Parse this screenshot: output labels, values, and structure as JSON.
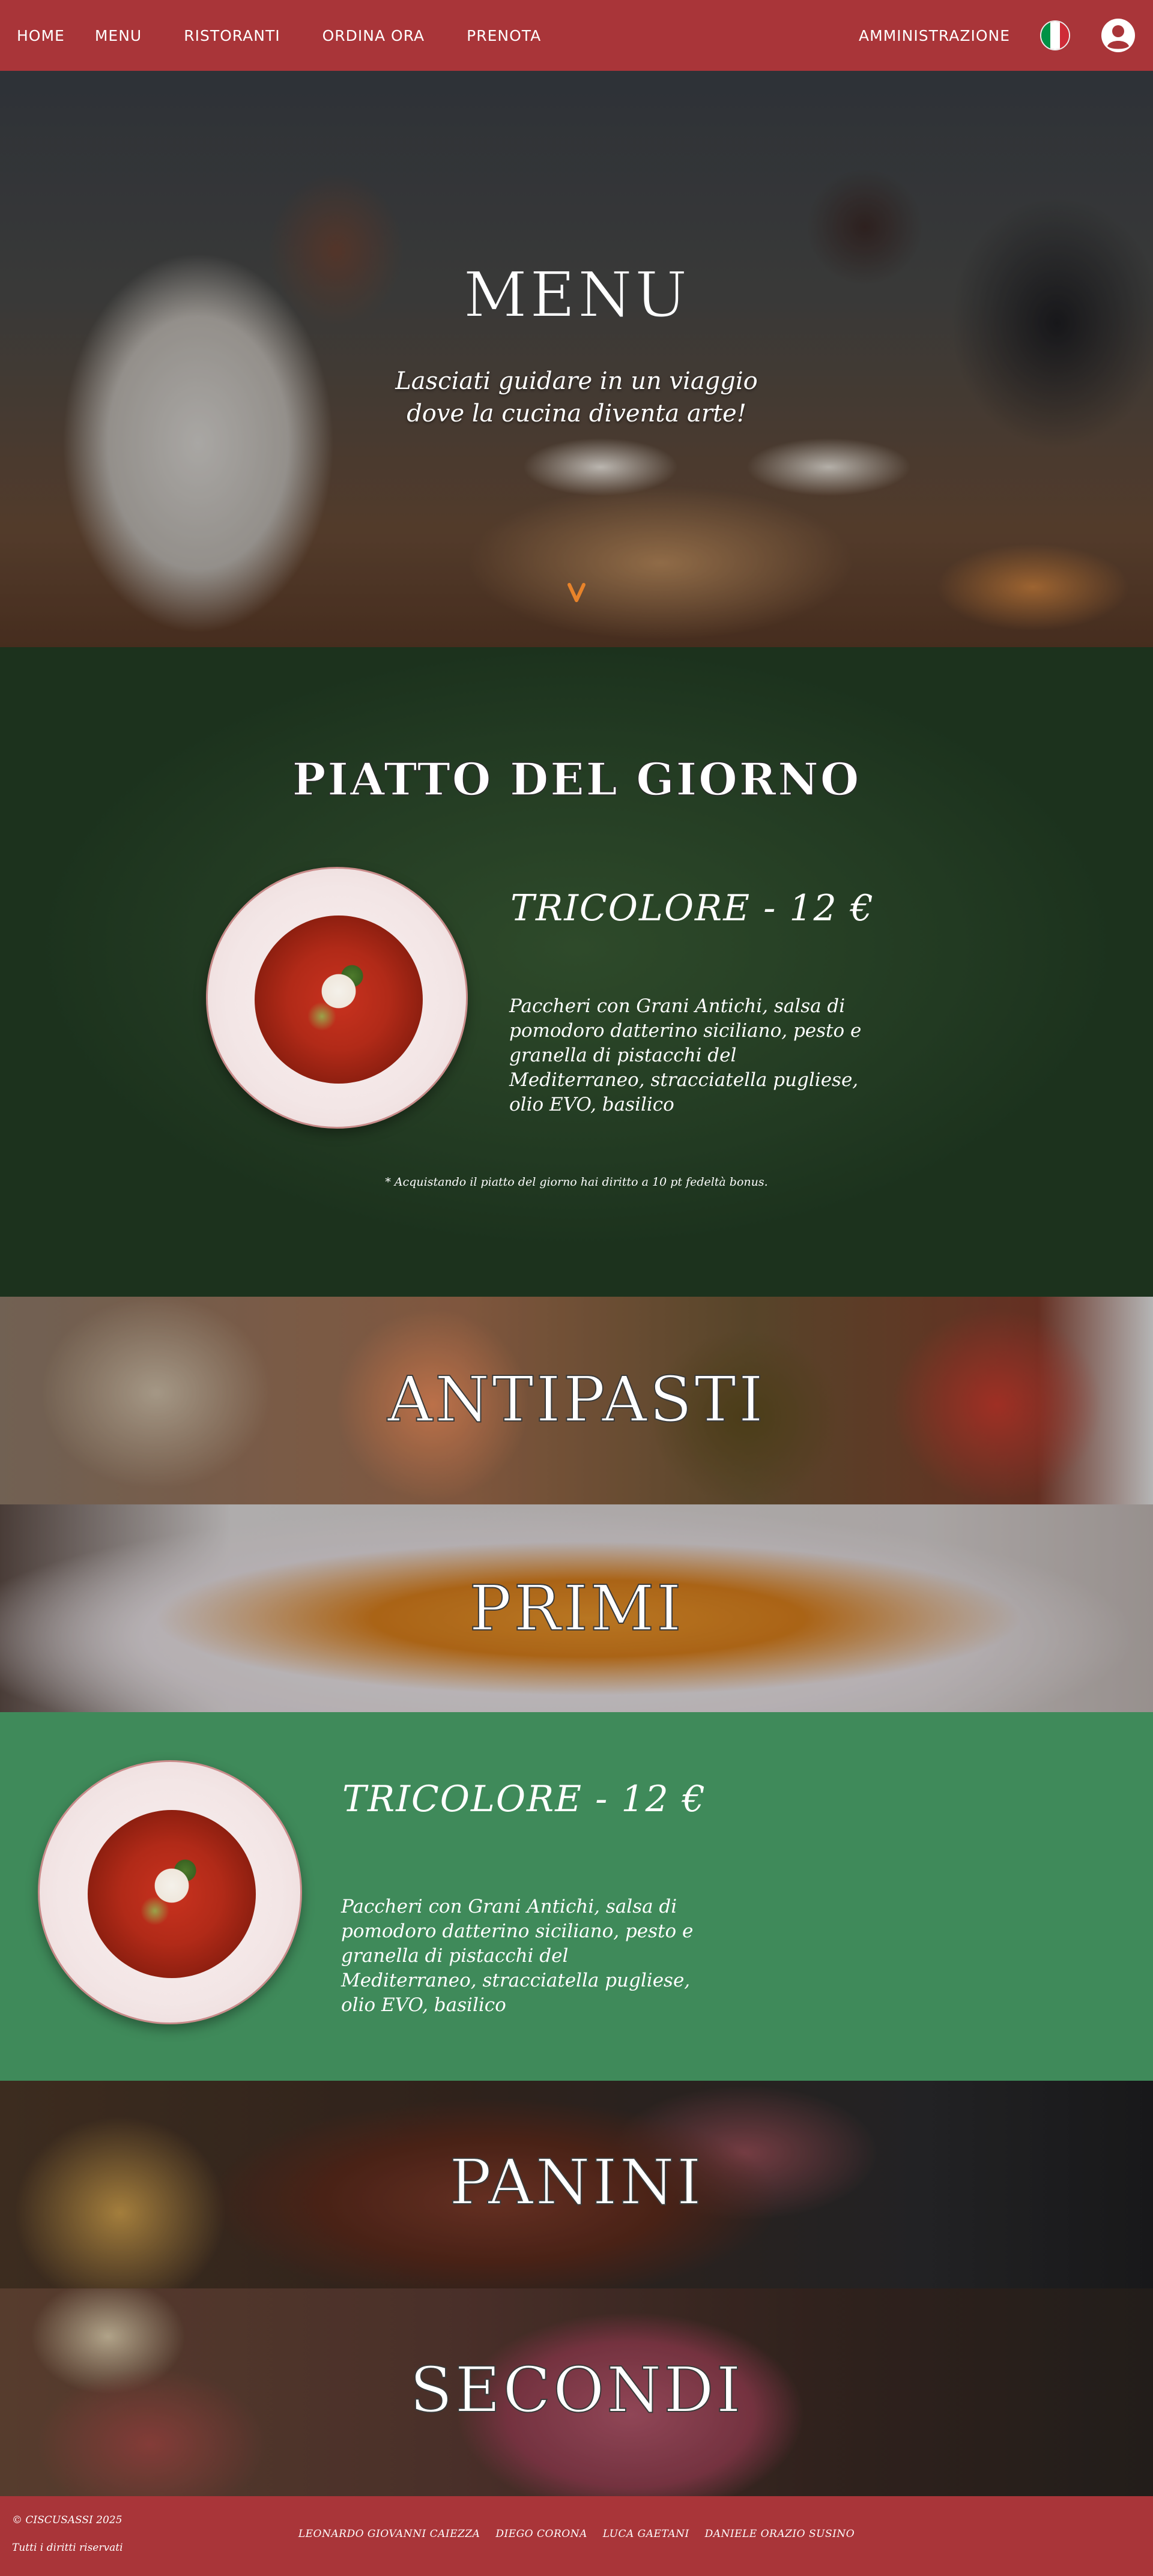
{
  "nav": {
    "links": [
      "HOME",
      "MENU",
      "RISTORANTI",
      "ORDINA ORA",
      "PRENOTA"
    ],
    "admin_label": "AMMINISTRAZIONE",
    "flag_colors": [
      "#009246",
      "#ffffff",
      "#ce2b37"
    ],
    "user_icon": "user-circle-icon"
  },
  "hero": {
    "title": "MENU",
    "subtitle_line1": "Lasciati guidare in un viaggio",
    "subtitle_line2": "dove la cucina diventa arte!",
    "scroll_icon": "chevron-down-icon"
  },
  "piatto_del_giorno": {
    "title": "PIATTO DEL GIORNO",
    "dish_name": "TRICOLORE - 12 €",
    "description": [
      "Paccheri con Grani Antichi, salsa di",
      "pomodoro datterino siciliano, pesto e",
      "granella di pistacchi del",
      "Mediterraneo, stracciatella pugliese,",
      "olio  EVO, basilico"
    ],
    "note": "* Acquistando il piatto del giorno hai diritto a 10 pt fedeltà bonus."
  },
  "categories": {
    "antipasti": "ANTIPASTI",
    "primi": "PRIMI",
    "panini": "PANINI",
    "secondi": "SECONDI"
  },
  "primi_item": {
    "dish_name": "TRICOLORE - 12 €",
    "description": [
      "Paccheri con Grani Antichi, salsa di",
      "pomodoro datterino siciliano, pesto e",
      "granella di pistacchi del",
      "Mediterraneo, stracciatella pugliese,",
      "olio  EVO, basilico"
    ]
  },
  "footer": {
    "copyright": "© CISCUSASSI 2025",
    "rights": "Tutti i diritti riservati",
    "authors": [
      "LEONARDO GIOVANNI CAIEZZA",
      "DIEGO CORONA",
      "LUCA GAETANI",
      "DANIELE ORAZIO SUSINO"
    ]
  },
  "colors": {
    "brand_red": "#a93539",
    "board_green": "#223a22",
    "item_green": "#3f8a5a",
    "accent_orange": "#e8832a"
  }
}
